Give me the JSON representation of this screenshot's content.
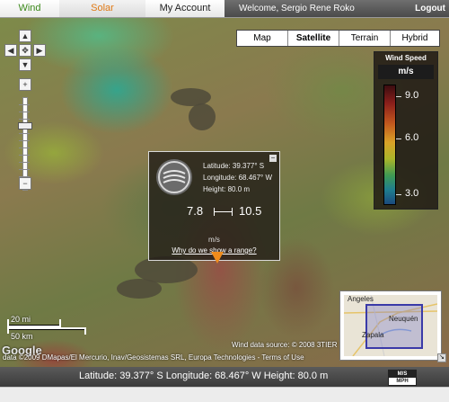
{
  "tabs": {
    "wind": "Wind",
    "solar": "Solar",
    "account": "My Account"
  },
  "header": {
    "welcome": "Welcome, Sergio Rene Roko",
    "logout": "Logout"
  },
  "map_types": {
    "map": "Map",
    "satellite": "Satellite",
    "terrain": "Terrain",
    "hybrid": "Hybrid",
    "selected": "Satellite"
  },
  "legend": {
    "title": "Wind Speed",
    "unit": "m/s",
    "max": "9.0",
    "mid": "6.0",
    "min": "3.0"
  },
  "popup": {
    "latitude": "Latitude: 39.377° S",
    "longitude": "Longitude: 68.467° W",
    "height": "Height: 80.0 m",
    "range_min": "7.8",
    "range_max": "10.5",
    "range_unit": "m/s",
    "link": "Why do we show a range?"
  },
  "scale": {
    "miles": "20 mi",
    "km": "50 km"
  },
  "attribution": {
    "google": "Google",
    "source": "Wind data source: © 2008 3TIER",
    "copyright": "data ©2009 DMapas/El Mercurio, Inav/Geosistemas SRL, Europa Technologies - Terms of Use"
  },
  "overview": {
    "city1": "Angeles",
    "city2": "Neuquén",
    "city3": "Zapala"
  },
  "statusbar": {
    "text": "Latitude: 39.377° S  Longitude: 68.467° W Height: 80.0 m",
    "unit_ms": "M/S",
    "unit_mph": "MPH"
  },
  "colors": {
    "wind_tab": "#3d8a1c",
    "solar_tab": "#e07a16",
    "pointer": "#f08c1c"
  }
}
